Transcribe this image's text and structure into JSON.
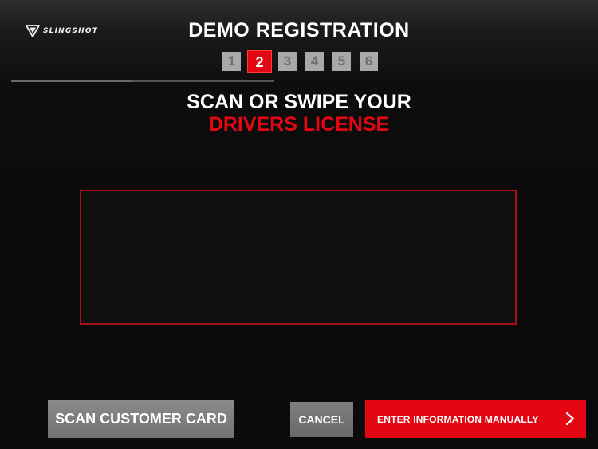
{
  "brand": {
    "logo_text": "SLINGSHOT",
    "logo_icon": "slingshot-shield-icon"
  },
  "header": {
    "title": "DEMO REGISTRATION"
  },
  "steps": {
    "items": [
      "1",
      "2",
      "3",
      "4",
      "5",
      "6"
    ],
    "active": "2"
  },
  "progress": {
    "fraction": 0.46
  },
  "instruction": {
    "line1": "SCAN OR SWIPE YOUR",
    "line2": "DRIVERS LICENSE"
  },
  "scan_area": {
    "label": ""
  },
  "actions": {
    "scan_card_label": "SCAN CUSTOMER CARD",
    "cancel_label": "CANCEL",
    "manual_label": "ENTER INFORMATION MANUALLY",
    "manual_icon": "chevron-right-icon"
  },
  "colors": {
    "accent": "#e30613",
    "button_gray": "#7a7a7a",
    "step_inactive": "#a9a9a9",
    "background": "#0a0a0a"
  }
}
